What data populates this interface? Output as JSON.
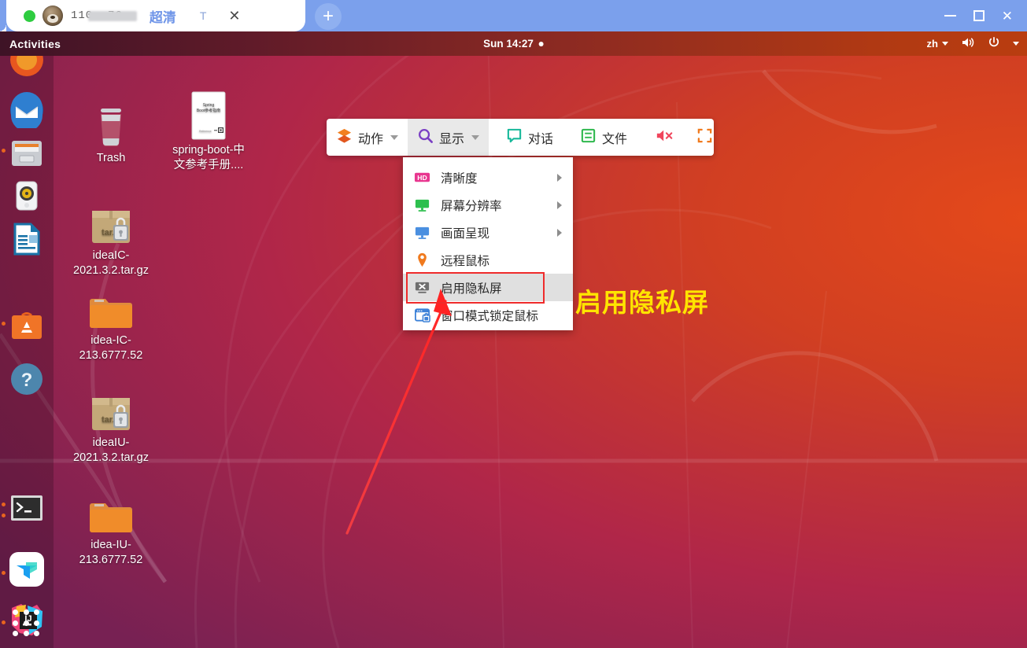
{
  "window": {
    "tab": {
      "status_dot": "green-status-dot",
      "avatar": "bear-avatar",
      "title": "110.       76",
      "quality_label": "超清",
      "text_mode_label": "T",
      "close_label": "✕",
      "new_tab_label": "+"
    },
    "controls": {
      "minimize": "minimize-icon",
      "maximize": "maximize-icon",
      "close": "✕"
    },
    "chrome_color": "#7ba0ec"
  },
  "topbar": {
    "activities": "Activities",
    "clock": "Sun 14:27",
    "keyboard_layout": "zh",
    "volume_icon": "volume-icon",
    "power_icon": "power-icon"
  },
  "dock": {
    "items": [
      {
        "name": "firefox",
        "label": "Firefox"
      },
      {
        "name": "thunderbird",
        "label": "Thunderbird Mail"
      },
      {
        "name": "files",
        "label": "Files"
      },
      {
        "name": "rhythmbox",
        "label": "Rhythmbox"
      },
      {
        "name": "libreoffice-writer",
        "label": "LibreOffice Writer"
      },
      {
        "name": "ubuntu-software",
        "label": "Ubuntu Software"
      },
      {
        "name": "help",
        "label": "Help"
      },
      {
        "name": "terminal",
        "label": "Terminal"
      },
      {
        "name": "todesk",
        "label": "ToDesk"
      },
      {
        "name": "intellij-idea",
        "label": "IntelliJ IDEA"
      }
    ],
    "show_apps_label": "Show Applications"
  },
  "desktop_icons": [
    {
      "name": "trash",
      "label": "Trash",
      "icon": "trash-icon"
    },
    {
      "name": "spring-boot-pdf",
      "label": "spring-boot-中文参考手册....",
      "icon": "pdf-icon"
    },
    {
      "name": "ideaic-targz",
      "label": "ideaIC-2021.3.2.tar.gz",
      "icon": "archive-icon"
    },
    {
      "name": "idea-ic-folder",
      "label": "idea-IC-213.6777.52",
      "icon": "folder-icon"
    },
    {
      "name": "ideaiu-targz",
      "label": "ideaIU-2021.3.2.tar.gz",
      "icon": "archive-icon"
    },
    {
      "name": "idea-iu-folder",
      "label": "idea-IU-213.6777.52",
      "icon": "folder-icon"
    }
  ],
  "toolbar": {
    "items": [
      {
        "name": "actions",
        "label": "动作",
        "icon": "layers-icon",
        "has_caret": true,
        "active": false
      },
      {
        "name": "display",
        "label": "显示",
        "icon": "magnifier-icon",
        "has_caret": true,
        "active": true
      },
      {
        "name": "chat",
        "label": "对话",
        "icon": "chat-bubble-icon",
        "has_caret": false,
        "active": false
      },
      {
        "name": "files",
        "label": "文件",
        "icon": "file-list-icon",
        "has_caret": false,
        "active": false
      },
      {
        "name": "mute",
        "label": "",
        "icon": "speaker-muted-icon",
        "has_caret": false,
        "active": false
      },
      {
        "name": "fullscreen",
        "label": "",
        "icon": "fullscreen-icon",
        "has_caret": false,
        "active": false
      }
    ]
  },
  "dropdown": {
    "items": [
      {
        "name": "clarity",
        "label": "清晰度",
        "icon": "hd-icon",
        "submenu": true,
        "highlighted": false
      },
      {
        "name": "screen-resolution",
        "label": "屏幕分辨率",
        "icon": "green-monitor-icon",
        "submenu": true,
        "highlighted": false
      },
      {
        "name": "picture-presentation",
        "label": "画面呈现",
        "icon": "blue-monitor-icon",
        "submenu": true,
        "highlighted": false
      },
      {
        "name": "remote-mouse",
        "label": "远程鼠标",
        "icon": "mouse-pin-icon",
        "submenu": false,
        "highlighted": false
      },
      {
        "name": "enable-privacy-screen",
        "label": "启用隐私屏",
        "icon": "privacy-screen-icon",
        "submenu": false,
        "highlighted": true
      },
      {
        "name": "window-mode-lock-mouse",
        "label": "窗口模式锁定鼠标",
        "icon": "window-lock-icon",
        "submenu": false,
        "highlighted": false
      }
    ]
  },
  "annotation": {
    "text": "启用隐私屏",
    "text_color": "#ffe400",
    "highlight_color": "#ef2b2b",
    "arrow_color": "#ff3333"
  }
}
